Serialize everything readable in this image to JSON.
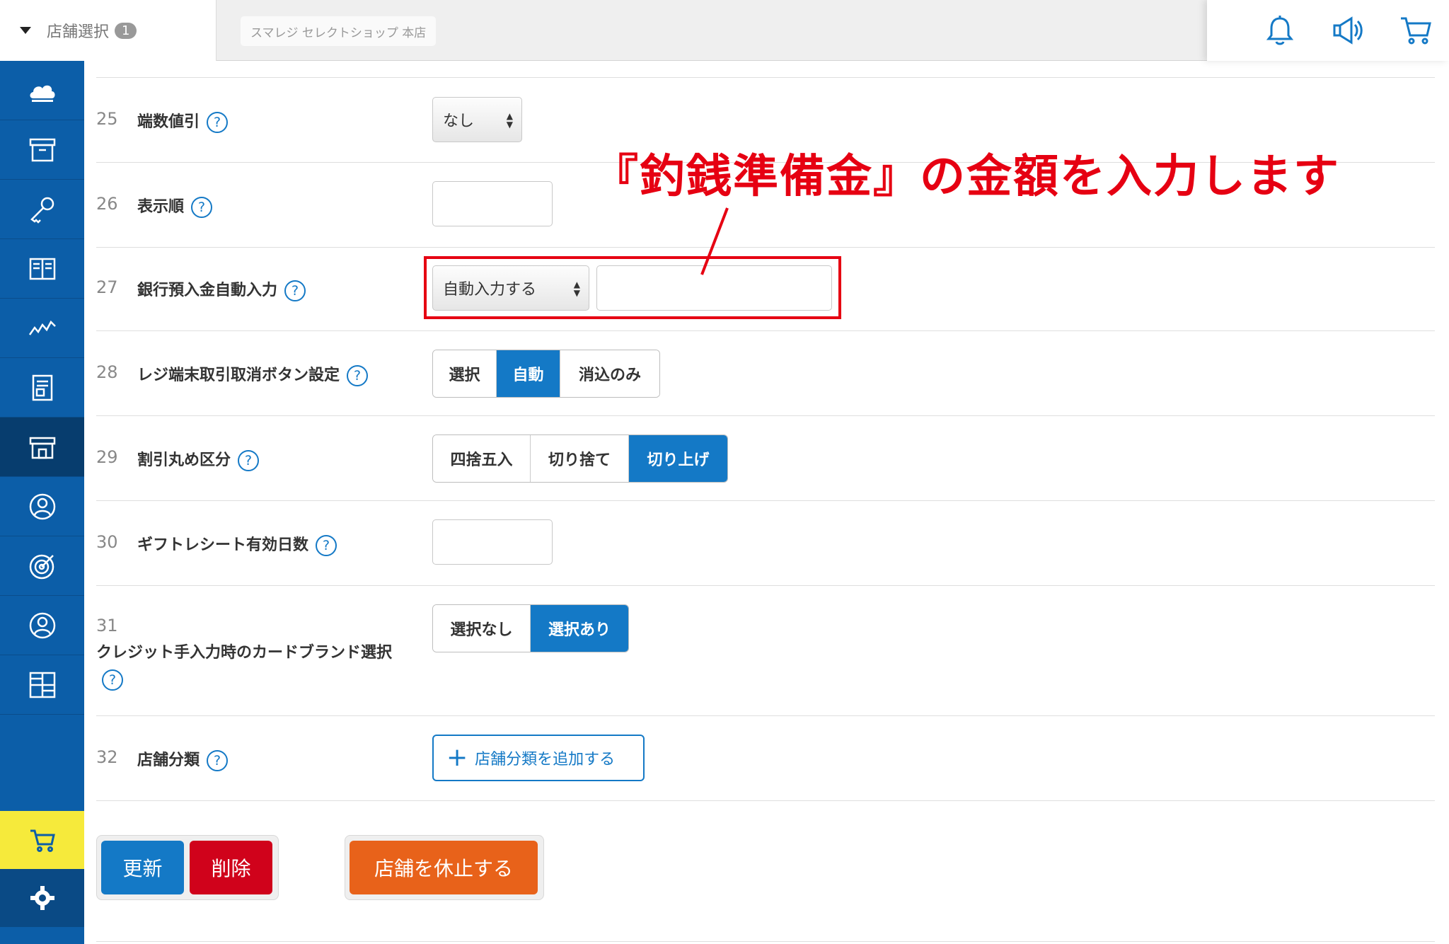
{
  "header": {
    "store_select_label": "店舗選択",
    "store_count": "1",
    "store_name": "スマレジ セレクトショップ 本店"
  },
  "rows": [
    {
      "num": "25",
      "label": "端数値引",
      "select_value": "なし"
    },
    {
      "num": "26",
      "label": "表示順"
    },
    {
      "num": "27",
      "label": "銀行預入金自動入力",
      "select_value": "自動入力する"
    },
    {
      "num": "28",
      "label": "レジ端末取引取消ボタン設定",
      "options": [
        "選択",
        "自動",
        "消込のみ"
      ],
      "selected": "自動"
    },
    {
      "num": "29",
      "label": "割引丸め区分",
      "options": [
        "四捨五入",
        "切り捨て",
        "切り上げ"
      ],
      "selected": "切り上げ"
    },
    {
      "num": "30",
      "label": "ギフトレシート有効日数"
    },
    {
      "num": "31",
      "label": "クレジット手入力時のカードブランド選択",
      "options": [
        "選択なし",
        "選択あり"
      ],
      "selected": "選択あり"
    },
    {
      "num": "32",
      "label": "店舗分類",
      "add_button": "店舗分類を追加する"
    }
  ],
  "help_symbol": "?",
  "annotation": "『釣銭準備金』の金額を入力します",
  "footer": {
    "update": "更新",
    "delete": "削除",
    "suspend": "店舗を休止する"
  },
  "colors": {
    "sidebar": "#0c5ea8",
    "accent": "#1479c6",
    "danger": "#d0021b",
    "orange": "#e8621a",
    "annotation": "#e60012"
  }
}
